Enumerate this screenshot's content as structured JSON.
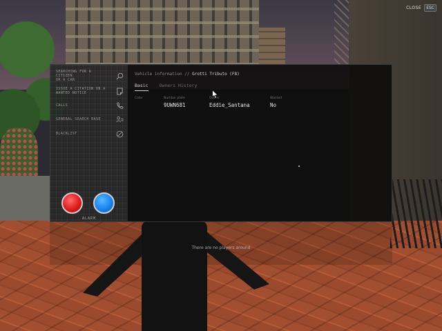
{
  "close": {
    "label": "CLOSE",
    "key": "ESC"
  },
  "sidebar": {
    "items": [
      {
        "label": "SEARCHING FOR A\nCITIZEN\nOR A CAR",
        "icon": "search-icon"
      },
      {
        "label": "ISSUE A CITATION ON A\nWANTED NOTICE",
        "icon": "note-icon"
      },
      {
        "label": "CALLS",
        "icon": "phone-icon"
      },
      {
        "label": "GENERAL SEARCH BASE",
        "icon": "person-list-icon"
      },
      {
        "label": "BLACKLIST",
        "icon": "block-icon"
      }
    ],
    "alarm_label": "ALARM"
  },
  "content": {
    "breadcrumb_prefix": "Vehicle information //",
    "breadcrumb_current": "Grotti Tributo (F8)",
    "tabs": [
      {
        "label": "Basic",
        "active": true
      },
      {
        "label": "Owners History",
        "active": false
      }
    ],
    "columns": [
      {
        "header": "Color",
        "value": ""
      },
      {
        "header": "Number plate",
        "value": "9UWN681"
      },
      {
        "header": "Owner",
        "value": "Eddie_Santana"
      },
      {
        "header": "Wanted",
        "value": "No"
      }
    ]
  },
  "notice": "There are no players around",
  "colors": {
    "alarm_red": "#e01b1b",
    "alarm_blue": "#1a83f0"
  }
}
